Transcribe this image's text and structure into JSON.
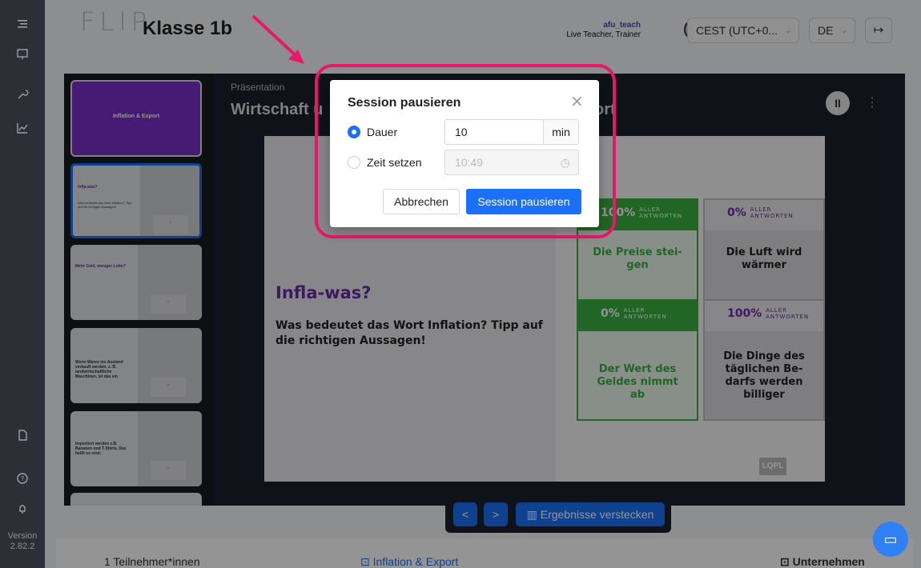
{
  "header": {
    "logo": "FLIP",
    "class_name": "Klasse 1b",
    "user_name": "afu_teach",
    "user_role": "Live Teacher, Trainer",
    "timezone": "CEST (UTC+0...",
    "language": "DE"
  },
  "sidebar": {
    "version_label": "Version",
    "version": "2.82.2"
  },
  "thumbnails": [
    {
      "title": "Inflation & Export",
      "subtitle": ""
    },
    {
      "title": "Infla-was?",
      "subtitle": "Was bedeutet das Wort Inflation? Tipp auf die richtigen Aussagen!"
    },
    {
      "title": "Mehr Geld, weniger Lohn?",
      "subtitle": ""
    },
    {
      "title": "Wenn Waren ins Ausland verkauft werden, z. B. landwirtschaftliche Maschinen, ist das ein",
      "subtitle": ""
    },
    {
      "title": "Importiert werden z.B. Bananen und T-Shirts. Das heißt es sind:",
      "subtitle": ""
    }
  ],
  "presentation": {
    "label": "Präsentation",
    "title_left": "Wirtschaft u",
    "title_right": "ort"
  },
  "slide": {
    "title": "Infla-was?",
    "question": "Was bedeutet das Wort Inflation? Tipp auf die richtigen Aussagen!",
    "watermark": "LQPL",
    "answers": [
      {
        "percent": "100%",
        "suffix_top": "ALLER",
        "suffix_bottom": "ANTWORTEN",
        "text": "Die Preise stei-gen",
        "correct": true
      },
      {
        "percent": "0%",
        "suffix_top": "ALLER",
        "suffix_bottom": "ANTWORTEN",
        "text": "Die Luft wird wärmer",
        "correct": false
      },
      {
        "percent": "0%",
        "suffix_top": "ALLER",
        "suffix_bottom": "ANTWORTEN",
        "text": "Der Wert des Geldes nimmt ab",
        "correct": true
      },
      {
        "percent": "100%",
        "suffix_top": "ALLER",
        "suffix_bottom": "ANTWORTEN",
        "text": "Die Dinge des täglichen Be-darfs werden billiger",
        "correct": false
      }
    ]
  },
  "controls": {
    "prev": "<",
    "next": ">",
    "toggle_results": "Ergebnisse verstecken"
  },
  "bottom": {
    "participants": "1 Teilnehmer*innen",
    "current": "Inflation & Export",
    "next": "Unternehmen"
  },
  "modal": {
    "title": "Session pausieren",
    "duration_label": "Dauer",
    "duration_value": "10",
    "duration_unit": "min",
    "time_label": "Zeit setzen",
    "time_value": "10:49",
    "cancel": "Abbrechen",
    "confirm": "Session pausieren"
  },
  "colors": {
    "accent": "#1b70f7",
    "highlight": "#e8176a",
    "correct": "#3cb043",
    "brand_purple": "#6b2ba5"
  }
}
